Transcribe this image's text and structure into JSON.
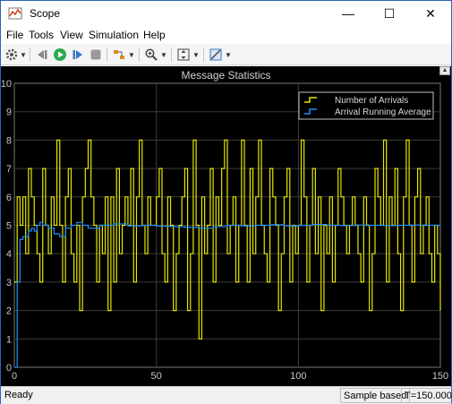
{
  "window": {
    "title": "Scope",
    "controls": {
      "minimize": "—",
      "maximize": "☐",
      "close": "✕"
    }
  },
  "menu": {
    "items": [
      "File",
      "Tools",
      "View",
      "Simulation",
      "Help"
    ],
    "dock_arrow": "➘"
  },
  "toolbar": {
    "icons": [
      "gear-icon",
      "step-back-icon",
      "run-icon",
      "step-forward-icon",
      "stop-icon",
      "highlight-icon",
      "zoom-icon",
      "scale-axes-icon",
      "measurements-icon"
    ]
  },
  "colors": {
    "plot_background": "#000000",
    "grid": "#3c3c3c",
    "axis_text": "#c8c8c8",
    "arrivals": "#e6e600",
    "average": "#1e90ff"
  },
  "chart_data": {
    "type": "line",
    "title": "Message Statistics",
    "xlim": [
      0,
      150
    ],
    "ylim": [
      0,
      10
    ],
    "x_ticks": [
      "0",
      "50",
      "100",
      "150"
    ],
    "y_ticks": [
      "0",
      "1",
      "2",
      "3",
      "4",
      "5",
      "6",
      "7",
      "8",
      "9",
      "10"
    ],
    "grid": true,
    "legend_position": "top-right",
    "series": [
      {
        "name": "Number of Arrivals",
        "style": "stairs",
        "color": "#e6e600",
        "x": [
          0,
          1,
          2,
          3,
          4,
          5,
          6,
          7,
          8,
          9,
          10,
          11,
          12,
          13,
          14,
          15,
          16,
          17,
          18,
          19,
          20,
          21,
          22,
          23,
          24,
          25,
          26,
          27,
          28,
          29,
          30,
          31,
          32,
          33,
          34,
          35,
          36,
          37,
          38,
          39,
          40,
          41,
          42,
          43,
          44,
          45,
          46,
          47,
          48,
          49,
          50,
          51,
          52,
          53,
          54,
          55,
          56,
          57,
          58,
          59,
          60,
          61,
          62,
          63,
          64,
          65,
          66,
          67,
          68,
          69,
          70,
          71,
          72,
          73,
          74,
          75,
          76,
          77,
          78,
          79,
          80,
          81,
          82,
          83,
          84,
          85,
          86,
          87,
          88,
          89,
          90,
          91,
          92,
          93,
          94,
          95,
          96,
          97,
          98,
          99,
          100,
          101,
          102,
          103,
          104,
          105,
          106,
          107,
          108,
          109,
          110,
          111,
          112,
          113,
          114,
          115,
          116,
          117,
          118,
          119,
          120,
          121,
          122,
          123,
          124,
          125,
          126,
          127,
          128,
          129,
          130,
          131,
          132,
          133,
          134,
          135,
          136,
          137,
          138,
          139,
          140,
          141,
          142,
          143,
          144,
          145,
          146,
          147,
          148,
          149,
          150
        ],
        "values": [
          3,
          6,
          5,
          6,
          4,
          7,
          6,
          5,
          4,
          3,
          7,
          5,
          4,
          6,
          5,
          8,
          5,
          3,
          6,
          7,
          4,
          3,
          5,
          2,
          6,
          7,
          8,
          6,
          5,
          3,
          5,
          4,
          6,
          2,
          6,
          3,
          7,
          4,
          5,
          6,
          5,
          7,
          3,
          6,
          8,
          5,
          4,
          6,
          5,
          5,
          6,
          7,
          4,
          3,
          6,
          5,
          2,
          4,
          5,
          6,
          7,
          2,
          4,
          8,
          5,
          1,
          6,
          4,
          5,
          7,
          3,
          6,
          5,
          7,
          8,
          4,
          5,
          6,
          3,
          5,
          8,
          5,
          3,
          7,
          4,
          6,
          8,
          5,
          4,
          3,
          7,
          6,
          5,
          2,
          4,
          6,
          7,
          3,
          5,
          4,
          5,
          8,
          6,
          3,
          5,
          7,
          4,
          6,
          2,
          5,
          4,
          6,
          3,
          5,
          7,
          6,
          5,
          4,
          5,
          6,
          5,
          4,
          3,
          6,
          5,
          2,
          4,
          7,
          6,
          5,
          8,
          3,
          6,
          5,
          7,
          4,
          2,
          6,
          8,
          5,
          3,
          6,
          7,
          4,
          5,
          6,
          4,
          3,
          5,
          4,
          2
        ]
      },
      {
        "name": "Arrival Running Average",
        "style": "stairs",
        "color": "#1e90ff",
        "x": [
          0,
          1,
          2,
          3,
          4,
          5,
          6,
          7,
          8,
          9,
          10,
          12,
          14,
          16,
          18,
          20,
          22,
          24,
          26,
          30,
          35,
          40,
          45,
          50,
          55,
          60,
          65,
          70,
          75,
          80,
          85,
          90,
          95,
          100,
          105,
          110,
          115,
          120,
          125,
          130,
          135,
          140,
          145,
          150
        ],
        "values": [
          0,
          3,
          4.5,
          4.6,
          4.6,
          4.8,
          4.9,
          4.8,
          5.0,
          5.1,
          5.0,
          4.9,
          4.7,
          4.6,
          4.9,
          5.0,
          5.1,
          5.0,
          4.9,
          5.0,
          5.05,
          4.98,
          5.0,
          4.97,
          4.95,
          4.93,
          4.9,
          4.95,
          5.0,
          4.98,
          5.0,
          5.02,
          4.98,
          5.0,
          5.03,
          5.0,
          4.99,
          5.01,
          5.0,
          4.99,
          5.0,
          5.01,
          5.0,
          5.0
        ]
      }
    ]
  },
  "status": {
    "state": "Ready",
    "mode": "Sample based",
    "time": "T=150.000"
  }
}
